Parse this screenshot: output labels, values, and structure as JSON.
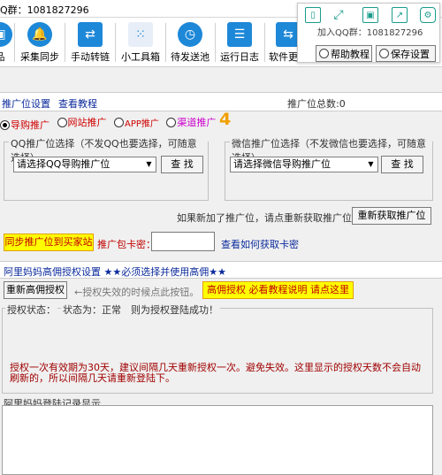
{
  "titlebar": {
    "qq_group": "Q群：1081827296"
  },
  "toolbar": {
    "items": [
      {
        "label": "品",
        "icon": "shop-icon"
      },
      {
        "label": "采集同步",
        "icon": "bell-icon"
      },
      {
        "label": "手动转链",
        "icon": "transfer-icon"
      },
      {
        "label": "小工具箱",
        "icon": "toolbox-icon"
      },
      {
        "label": "待发送池",
        "icon": "clock-icon"
      },
      {
        "label": "运行日志",
        "icon": "log-icon"
      },
      {
        "label": "软件更新",
        "icon": "update-icon"
      }
    ]
  },
  "overlay": {
    "join_text": "加入QQ群：1081827296",
    "help_label": "帮助教程",
    "save_label": "保存设置"
  },
  "nav": {
    "settings_link": "推广位设置",
    "tutorial_link": "查看教程",
    "total_label": "推广位总数:0"
  },
  "promo_types": [
    {
      "label": "导购推广",
      "color": "#d00000",
      "checked": true
    },
    {
      "label": "网站推广",
      "color": "#d00000",
      "checked": false
    },
    {
      "label": "APP推广",
      "color": "#d00000",
      "checked": false
    },
    {
      "label": "渠道推广",
      "color": "#cc00cc",
      "checked": false
    }
  ],
  "badge_number": "4",
  "qq_group_box": {
    "title": "QQ推广位选择（不发QQ也要选择，可随意选择）",
    "select": "请选择QQ导购推广位",
    "find_label": "查 找"
  },
  "wx_group_box": {
    "title": "微信推广位选择（不发微信也要选择，可随意选择）",
    "select": "请选择微信导购推广位",
    "find_label": "查 找"
  },
  "refresh": {
    "hint": "如果新加了推广位，请点重新获取推广位",
    "button": "重新获取推广位"
  },
  "sync": {
    "button": "同步推广位到买家站",
    "card_label": "推广包卡密：",
    "card_value": "",
    "how_link": "查看如何获取卡密"
  },
  "auth": {
    "section_title": "阿里妈妈高佣授权设置 ★★必须选择并使用高佣★★",
    "reauth_button": "重新高佣授权",
    "reauth_hint": "←授权失效的时候点此按钮。",
    "guide_button": "高佣授权 必看教程说明 请点这里",
    "status_title": "授权状态：",
    "status_text": "状态为：正常　则为授权登陆成功！",
    "note": "授权一次有效期为30天，建议间隔几天重新授权一次。避免失效。这里显示的授权天数不会自动刷新的，所以间隔几天请重新登陆下。"
  },
  "log": {
    "title": "阿里妈妈登陆记录显示"
  }
}
